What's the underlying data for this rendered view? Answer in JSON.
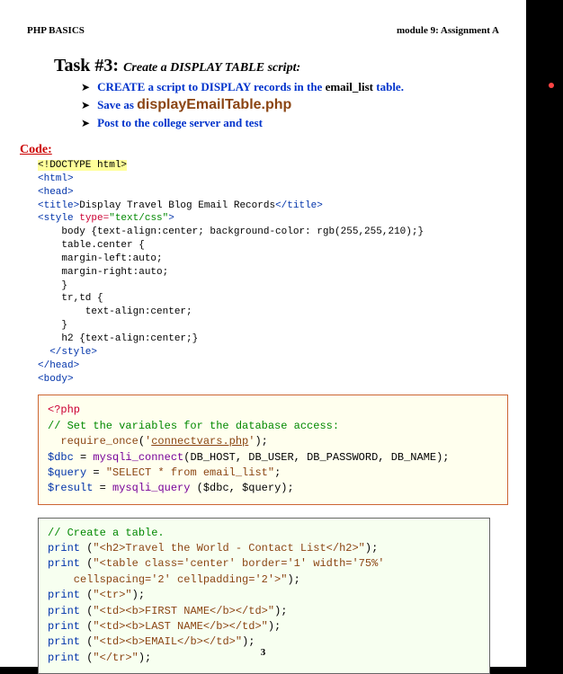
{
  "header": {
    "left": "PHP BASICS",
    "right": "module 9: Assignment A"
  },
  "task": {
    "prefix": "Task #3: ",
    "subtitle": "Create a DISPLAY TABLE script:",
    "bullets": [
      {
        "pre": "CREATE a script to DISPLAY records in the ",
        "boldblack": "email_list",
        "post": " table."
      },
      {
        "pre": "Save as  ",
        "filename": "displayEmailTable.php"
      },
      {
        "pre": "Post to the college server and test"
      }
    ]
  },
  "code_label": "Code:",
  "code1": {
    "l01": "<!DOCTYPE html>",
    "l02": "<html>",
    "l03": "<head>",
    "l04a": "  <title>",
    "l04b": "Display Travel Blog Email Records",
    "l04c": "</title>",
    "l05a": "  <style ",
    "l05b": "type=",
    "l05c": "\"text/css\"",
    "l05d": ">",
    "l06": "    body {text-align:center; background-color: rgb(255,255,210);}",
    "l07": "    table.center {",
    "l08": "    margin-left:auto;",
    "l09": "    margin-right:auto;",
    "l10": "    }",
    "l11": "    tr,td {",
    "l12": "        text-align:center;",
    "l13": "    }",
    "l14": "    h2 {text-align:center;}",
    "l15": "  </style>",
    "l16": "</head>",
    "l17": "<body>"
  },
  "code2": {
    "l01": "<?php",
    "l02": "// Set the variables for the database access:",
    "l03a": "  require_once",
    "l03b": "(",
    "l03c": "'",
    "l03d": "connectvars.php",
    "l03e": "'",
    "l03f": ");",
    "l04": "",
    "l05a": "$dbc",
    "l05b": " = ",
    "l05c": "mysqli_connect",
    "l05d": "(DB_HOST, DB_USER, DB_PASSWORD, DB_NAME);",
    "l06": "",
    "l07a": "$query",
    "l07b": " = ",
    "l07c": "\"SELECT * from email_list\"",
    "l07d": ";",
    "l08a": "$result",
    "l08b": " = ",
    "l08c": "mysqli_query ",
    "l08d": "($dbc, $query);"
  },
  "code3": {
    "l01": "// Create a table.",
    "l02a": "print ",
    "l02b": "(",
    "l02c": "\"<h2>Travel the World - Contact List</h2>\"",
    "l02d": ");",
    "l03a": "print ",
    "l03b": "(",
    "l03c": "\"<table class='center' border='1' width='75%'",
    "l04c": "    cellspacing='2' cellpadding='2'>\"",
    "l04d": ");",
    "l05a": "print ",
    "l05b": "(",
    "l05c": "\"<tr>\"",
    "l05d": ");",
    "l06a": "print ",
    "l06b": "(",
    "l06c": "\"<td><b>FIRST NAME</b></td>\"",
    "l06d": ");",
    "l07a": "print ",
    "l07b": "(",
    "l07c": "\"<td><b>LAST NAME</b></td>\"",
    "l07d": ");",
    "l08a": "print ",
    "l08b": "(",
    "l08c": "\"<td><b>EMAIL</b></td>\"",
    "l08d": ");",
    "l09a": "print ",
    "l09b": "(",
    "l09c": "\"</tr>\"",
    "l09d": ");"
  },
  "page_number": "3"
}
